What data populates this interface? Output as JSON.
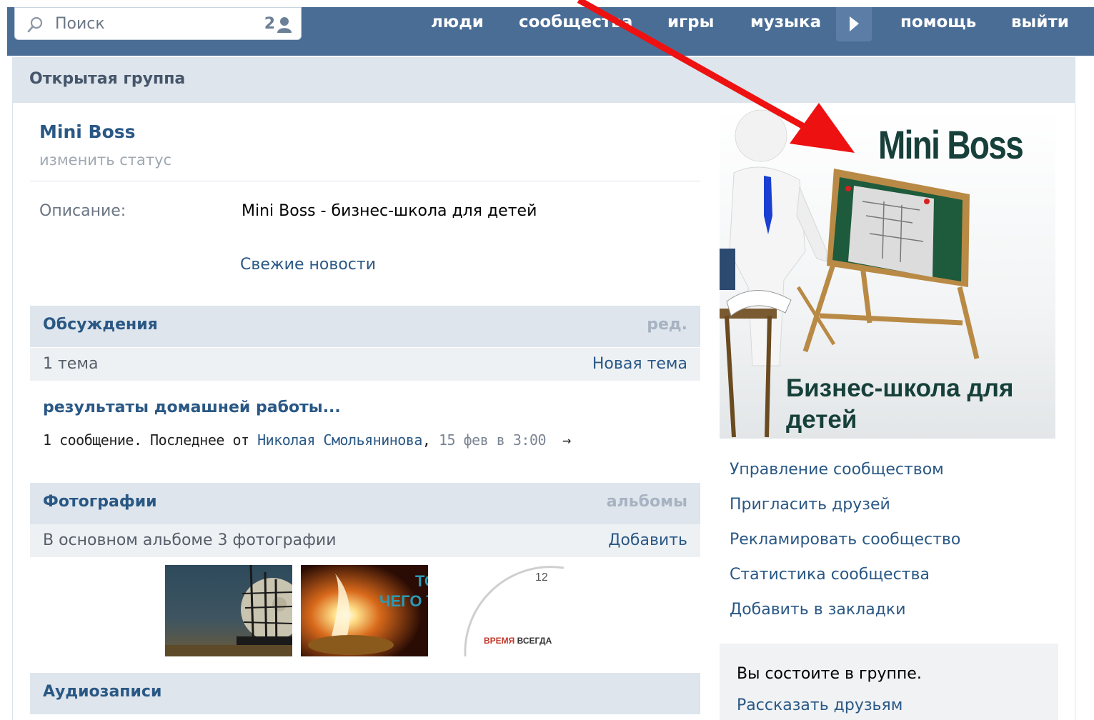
{
  "topbar": {
    "search_placeholder": "Поиск",
    "notif_count": "2",
    "nav": [
      "люди",
      "сообщества",
      "игры",
      "музыка",
      "помощь",
      "выйти"
    ]
  },
  "page": {
    "header": "Открытая группа",
    "group_name": "Mini Boss",
    "status_link": "изменить статус",
    "description_label": "Описание:",
    "description_value": "Mini Boss - бизнес-школа для детей",
    "fresh_news": "Свежие новости"
  },
  "discussions": {
    "title": "Обсуждения",
    "edit": "ред.",
    "count": "1 тема",
    "new_topic": "Новая тема",
    "topic_title": "результаты домашней работы...",
    "meta_prefix": "1 сообщение. Последнее от ",
    "meta_author": "Николая Смольянинова",
    "meta_sep": ", ",
    "meta_date": "15 фев в 3:00",
    "meta_arrow": "→"
  },
  "photos": {
    "title": "Фотографии",
    "albums": "альбомы",
    "summary": "В основном альбоме 3 фотографии",
    "add": "Добавить",
    "thumb2_text1": "ТО",
    "thumb2_text2": "ЧЕГО Т",
    "thumb3_clock": "12",
    "thumb3_red": "ВРЕМЯ",
    "thumb3_dark": " ВСЕГДА"
  },
  "audio": {
    "title": "Аудиозаписи"
  },
  "banner": {
    "title": "Mini Boss",
    "subtitle1": "Бизнес-школа для",
    "subtitle2": "детей"
  },
  "sidebar_links": [
    "Управление сообществом",
    "Пригласить друзей",
    "Рекламировать сообщество",
    "Статистика сообщества",
    "Добавить в закладки"
  ],
  "membership": {
    "status": "Вы состоите в группе.",
    "share": "Рассказать друзьям"
  },
  "colors": {
    "topbar": "#4a6d96",
    "link": "#2a5885",
    "section_bg": "#dee5ec",
    "annotation_arrow": "#ee1111"
  }
}
